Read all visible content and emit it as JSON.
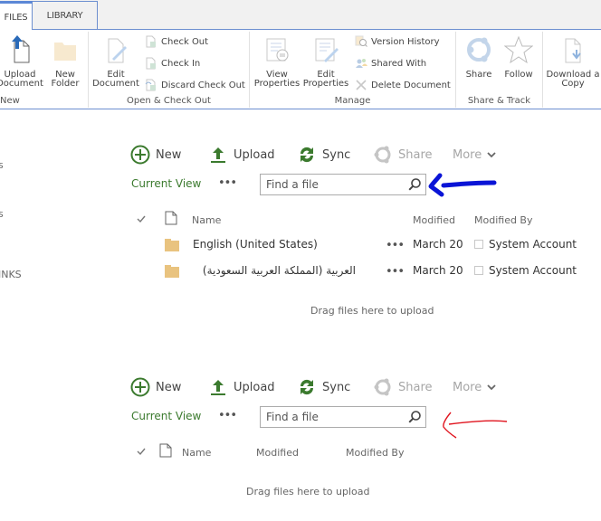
{
  "ribbon": {
    "tabs": [
      {
        "label": "FILES",
        "active": true
      },
      {
        "label": "LIBRARY",
        "active": false
      }
    ],
    "groups": {
      "new": {
        "label": "New",
        "upload_document": "Upload Document",
        "new_folder": "New Folder"
      },
      "open_checkout": {
        "label": "Open & Check Out",
        "edit_document": "Edit Document",
        "check_out": "Check Out",
        "check_in": "Check In",
        "discard_check_out": "Discard Check Out"
      },
      "manage": {
        "label": "Manage",
        "view_properties": "View Properties",
        "edit_properties": "Edit Properties",
        "version_history": "Version History",
        "shared_with": "Shared With",
        "delete_document": "Delete Document"
      },
      "share_track": {
        "label": "Share & Track",
        "share": "Share",
        "follow": "Follow"
      },
      "copies": {
        "download_copy": "Download a Copy"
      }
    }
  },
  "leftnav": {
    "items": [
      "s",
      "s",
      "INKS"
    ]
  },
  "library1": {
    "commands": {
      "new": "New",
      "upload": "Upload",
      "sync": "Sync",
      "share": "Share",
      "more": "More"
    },
    "current_view": "Current View",
    "ellipsis": "•••",
    "search_placeholder": "Find a file",
    "columns": {
      "name": "Name",
      "modified": "Modified",
      "modified_by": "Modified By"
    },
    "rows": [
      {
        "name": "English (United States)",
        "modified": "March 20",
        "modified_by": "System Account"
      },
      {
        "name": "العربية (المملكة العربية السعودية)",
        "modified": "March 20",
        "modified_by": "System Account"
      }
    ],
    "drag_hint": "Drag files here to upload",
    "annotation_color": "#0a14d6"
  },
  "library2": {
    "commands": {
      "new": "New",
      "upload": "Upload",
      "sync": "Sync",
      "share": "Share",
      "more": "More"
    },
    "current_view": "Current View",
    "ellipsis": "•••",
    "search_placeholder": "Find a file",
    "columns": {
      "name": "Name",
      "modified": "Modified",
      "modified_by": "Modified By"
    },
    "rows": [],
    "drag_hint": "Drag files here to upload",
    "annotation_color": "#e0141e"
  },
  "colors": {
    "accent_green": "#3b7a2e",
    "ribbon_border": "#6d8fd0",
    "folder": "#e9c37f"
  }
}
